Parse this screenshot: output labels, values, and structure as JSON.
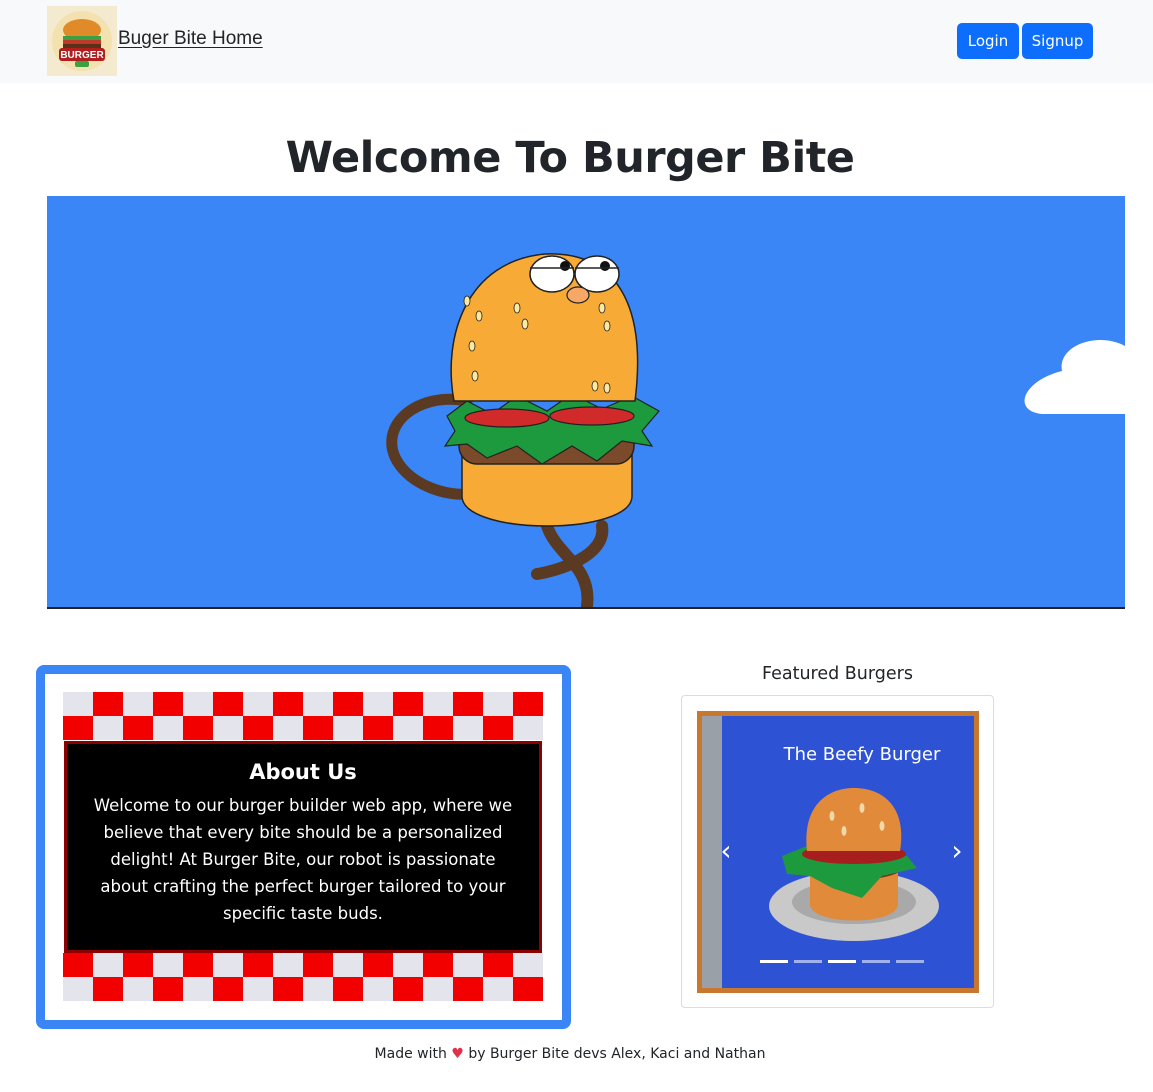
{
  "navbar": {
    "brand_label": "Buger Bite Home",
    "login_label": "Login",
    "signup_label": "Signup",
    "logo_text": "BURGER BITE"
  },
  "hero": {
    "title": "Welcome To Burger Bite"
  },
  "about": {
    "title": "About Us",
    "text": "Welcome to our burger builder web app, where we believe that every bite should be a personalized delight! At Burger Bite, our robot is passionate about crafting the perfect burger tailored to your specific taste buds."
  },
  "featured": {
    "title": "Featured Burgers",
    "slide_title": "The Beefy Burger",
    "prev_glyph": "‹",
    "next_glyph": "›",
    "slide_count": 5,
    "active_slide": 3
  },
  "footer": {
    "made_with": "Made with",
    "heart": "♥",
    "credits": "by Burger Bite devs Alex, Kaci and Nathan"
  },
  "colors": {
    "primary_button": "#0d6efd",
    "hero_bg": "#3a86f6",
    "about_frame": "#3a86f6",
    "checker_red": "#f20000",
    "checker_light": "#e4e4ec",
    "slide_bg": "#2d52d3",
    "slide_border": "#c8772e"
  }
}
